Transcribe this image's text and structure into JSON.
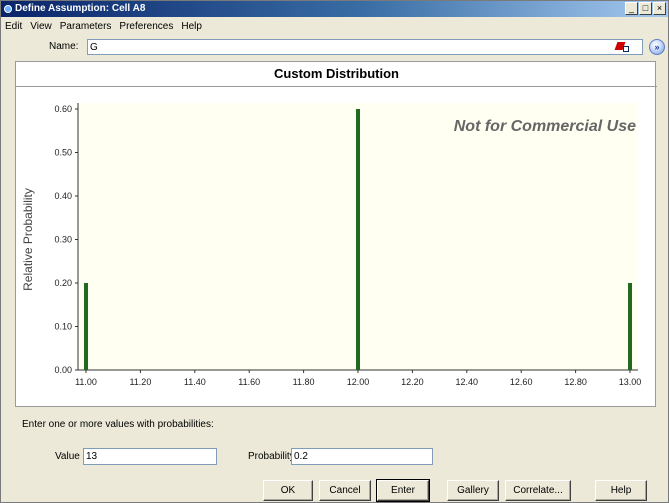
{
  "window": {
    "title": "Define Assumption: Cell A8",
    "controls": [
      "_",
      "□",
      "×"
    ]
  },
  "menu": [
    "Edit",
    "View",
    "Parameters",
    "Preferences",
    "Help"
  ],
  "name_field": {
    "label": "Name:",
    "value": "G"
  },
  "chart_data": {
    "type": "bar",
    "title": "Custom Distribution",
    "ylabel": "Relative Probability",
    "xlabel": "",
    "watermark": "Not for Commercial Use",
    "x": [
      11.0,
      12.0,
      13.0
    ],
    "values": [
      0.2,
      0.6,
      0.2
    ],
    "xlim": [
      11.0,
      13.0
    ],
    "ylim": [
      0,
      0.6
    ],
    "x_ticks": [
      "11.00",
      "11.20",
      "11.40",
      "11.60",
      "11.80",
      "12.00",
      "12.20",
      "12.40",
      "12.60",
      "12.80",
      "13.00"
    ],
    "y_ticks": [
      "0.00",
      "0.10",
      "0.20",
      "0.30",
      "0.40",
      "0.50",
      "0.60"
    ],
    "bar_color": "#1f6b1f",
    "plot_background": "#fffff2"
  },
  "entry": {
    "instruction": "Enter one or more values with probabilities:",
    "value_label": "Value",
    "value": "13",
    "probability_label": "Probability",
    "probability": "0.2"
  },
  "buttons": [
    "OK",
    "Cancel",
    "Enter",
    "Gallery",
    "Correlate...",
    "Help"
  ]
}
